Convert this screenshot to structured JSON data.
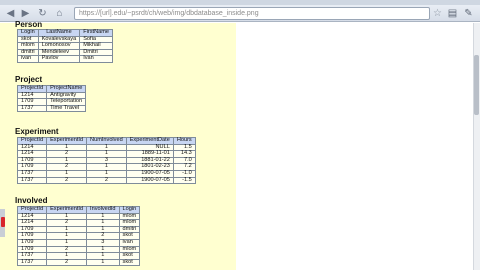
{
  "browser": {
    "url": "https://[url].edu/~psrdt/ch/web/img/dbdatabase_inside.png",
    "icons": {
      "back": "back-arrow-icon",
      "forward": "forward-arrow-icon",
      "reload": "reload-icon",
      "home": "home-icon",
      "star": "bookmark-star-icon",
      "page": "page-menu-icon",
      "tools": "wrench-icon"
    }
  },
  "sections": {
    "person": "Person",
    "project": "Project",
    "experiment": "Experiment",
    "involved": "Involved"
  },
  "person": {
    "columns": [
      "Login",
      "LastName",
      "FirstName"
    ],
    "rows": [
      [
        "skot",
        "Kovalevskaya",
        "Sofia"
      ],
      [
        "mlom",
        "Lomonosov",
        "Mikhail"
      ],
      [
        "dmitri",
        "Mendeleev",
        "Dmitri"
      ],
      [
        "ivan",
        "Pavlov",
        "Ivan"
      ]
    ]
  },
  "project": {
    "columns": [
      "ProjectId",
      "ProjectName"
    ],
    "rows": [
      [
        "1214",
        "Antigravity"
      ],
      [
        "1709",
        "Teleportation"
      ],
      [
        "1737",
        "Time Travel"
      ]
    ]
  },
  "experiment": {
    "columns": [
      "ProjectId",
      "ExperimentId",
      "NumInvolved",
      "ExperimentDate",
      "Hours"
    ],
    "rows": [
      [
        "1214",
        "1",
        "1",
        "NULL",
        "1.5"
      ],
      [
        "1214",
        "2",
        "1",
        "1889-11-01",
        "14.3"
      ],
      [
        "1709",
        "1",
        "3",
        "1881-01-22",
        "7.0"
      ],
      [
        "1709",
        "2",
        "1",
        "1801-02-23",
        "7.2"
      ],
      [
        "1737",
        "1",
        "1",
        "1900-07-05",
        "-1.0"
      ],
      [
        "1737",
        "2",
        "2",
        "1900-07-05",
        "-1.5"
      ]
    ]
  },
  "involved": {
    "columns": [
      "ProjectId",
      "ExperimentId",
      "InvolvedId",
      "Login"
    ],
    "rows": [
      [
        "1214",
        "1",
        "1",
        "mlom"
      ],
      [
        "1214",
        "2",
        "1",
        "mlom"
      ],
      [
        "1709",
        "1",
        "1",
        "dmitri"
      ],
      [
        "1709",
        "1",
        "2",
        "skot"
      ],
      [
        "1709",
        "1",
        "3",
        "ivan"
      ],
      [
        "1709",
        "2",
        "1",
        "mlom"
      ],
      [
        "1737",
        "1",
        "1",
        "skot"
      ],
      [
        "1737",
        "2",
        "1",
        "skot"
      ]
    ]
  }
}
